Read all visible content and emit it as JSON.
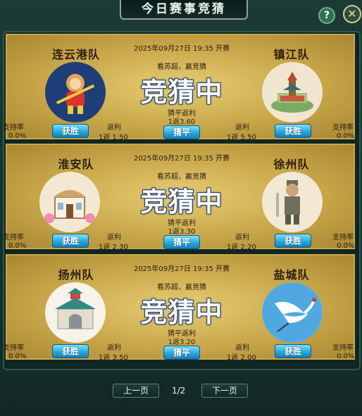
{
  "window": {
    "title": "今日赛事竞猜",
    "help_label": "?",
    "close_label": "✕"
  },
  "matches": [
    {
      "home": {
        "name": "连云港队",
        "logo": "monkey-king-icon",
        "win_label": "获胜",
        "rebate_label": "返利",
        "odds": "1返 1.50",
        "support_label": "支持率",
        "support_value": "0.0%"
      },
      "away": {
        "name": "镇江队",
        "logo": "temple-icon",
        "win_label": "获胜",
        "rebate_label": "返利",
        "odds": "1返 5.50",
        "support_label": "支持率",
        "support_value": "0.0%"
      },
      "datetime": "2025年09月27日 19:35 开赛",
      "slogan": "看苏超，赢竞猜",
      "status": "竞猜中",
      "draw_label": "猜平返利",
      "draw_odds": "1返3.60",
      "draw_button": "猜平"
    },
    {
      "home": {
        "name": "淮安队",
        "logo": "building-icon",
        "win_label": "获胜",
        "rebate_label": "返利",
        "odds": "1返 2.30",
        "support_label": "支持率",
        "support_value": "0.0%"
      },
      "away": {
        "name": "徐州队",
        "logo": "soldier-icon",
        "win_label": "获胜",
        "rebate_label": "返利",
        "odds": "1返 2.20",
        "support_label": "支持率",
        "support_value": "0.0%"
      },
      "datetime": "2025年09月27日 19:35 开赛",
      "slogan": "看苏超，赢竞猜",
      "status": "竞猜中",
      "draw_label": "猜平返利",
      "draw_odds": "1返3.30",
      "draw_button": "猜平"
    },
    {
      "home": {
        "name": "扬州队",
        "logo": "gate-icon",
        "win_label": "获胜",
        "rebate_label": "返利",
        "odds": "1返 3.50",
        "support_label": "支持率",
        "support_value": "0.0%"
      },
      "away": {
        "name": "盐城队",
        "logo": "crane-icon",
        "win_label": "获胜",
        "rebate_label": "返利",
        "odds": "1返 2.00",
        "support_label": "支持率",
        "support_value": "0.0%"
      },
      "datetime": "2025年09月27日 19:35 开赛",
      "slogan": "看苏超，赢竞猜",
      "status": "竞猜中",
      "draw_label": "猜平返利",
      "draw_odds": "1返3.20",
      "draw_button": "猜平"
    }
  ],
  "pager": {
    "prev": "上一页",
    "page": "1/2",
    "next": "下一页"
  }
}
